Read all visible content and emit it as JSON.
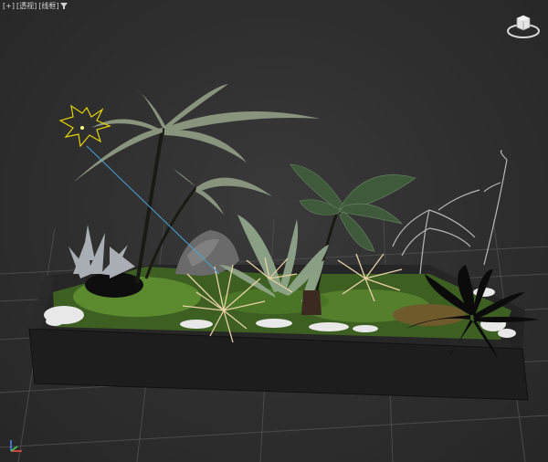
{
  "viewport": {
    "label_plus": "[+]",
    "label_view": "[透视]",
    "label_shading": "[线框]",
    "filter_icon": "funnel-icon"
  },
  "icons": {
    "viewcube": "viewcube-icon",
    "light": "sun-light-icon",
    "tripod": "axis-tripod-icon"
  },
  "colors": {
    "background": "#333333",
    "grid": "#4a4a4a",
    "planter": "#1d1d1d",
    "moss": "#4f7a2a",
    "pebbles": "#e8e8e8",
    "light_gizmo": "#e6d400",
    "light_target": "#4aa3d8"
  }
}
